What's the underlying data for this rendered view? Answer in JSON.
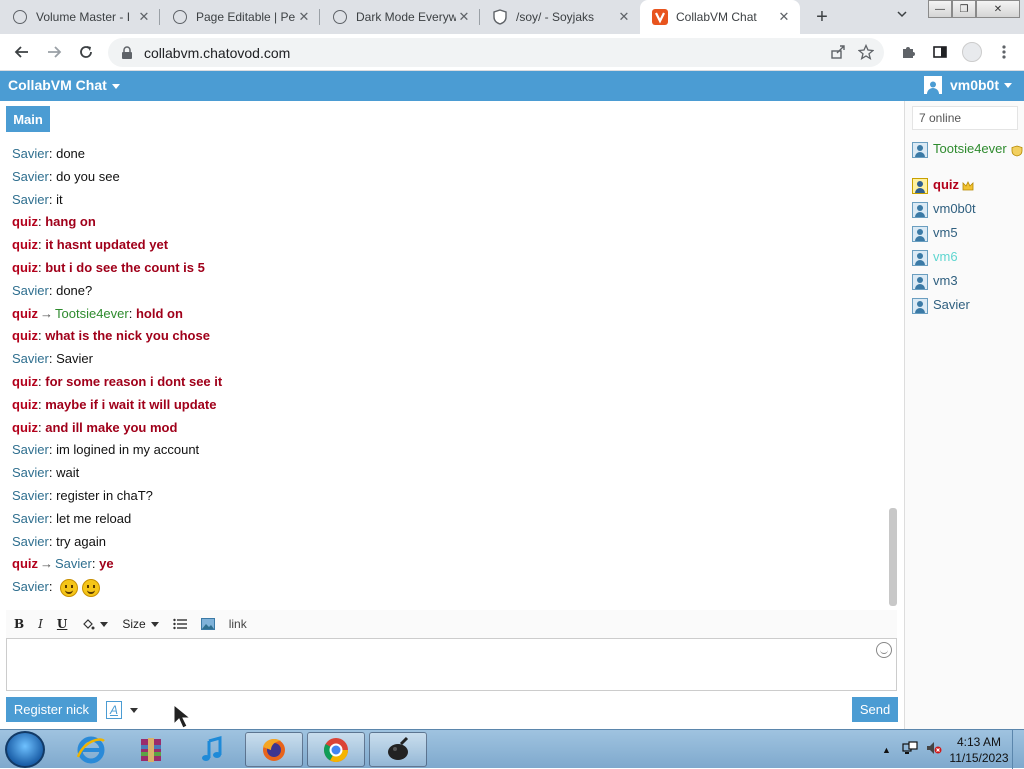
{
  "browser": {
    "tabs": [
      {
        "title": "Volume Master - I",
        "icon": "globe-outline"
      },
      {
        "title": "Page Editable | Pe",
        "icon": "globe-outline"
      },
      {
        "title": "Dark Mode Everyw",
        "icon": "globe-outline"
      },
      {
        "title": "/soy/ - Soyjaks",
        "icon": "shield"
      },
      {
        "title": "CollabVM Chat",
        "icon": "chatovod-v",
        "active": true
      }
    ],
    "url": "collabvm.chatovod.com"
  },
  "app": {
    "title": "CollabVM Chat",
    "username": "vm0b0t",
    "accent_color": "#4b9cd3",
    "active_room_tab": "Main"
  },
  "messages": [
    {
      "from": "Savier",
      "text": "done"
    },
    {
      "from": "Savier",
      "text": "do you see"
    },
    {
      "from": "Savier",
      "text": "it"
    },
    {
      "from": "quiz",
      "text": "hang on"
    },
    {
      "from": "quiz",
      "text": "it hasnt updated yet"
    },
    {
      "from": "quiz",
      "text": "but i do see the count is 5"
    },
    {
      "from": "Savier",
      "text": "done?"
    },
    {
      "from": "quiz",
      "to": "Tootsie4ever",
      "text": "hold on"
    },
    {
      "from": "quiz",
      "text": "what is the nick you chose"
    },
    {
      "from": "Savier",
      "text": "Savier"
    },
    {
      "from": "quiz",
      "text": "for some reason i dont see it"
    },
    {
      "from": "quiz",
      "text": "maybe if i wait it will update"
    },
    {
      "from": "quiz",
      "text": "and ill make you mod"
    },
    {
      "from": "Savier",
      "text": "im logined in my account"
    },
    {
      "from": "Savier",
      "text": "wait"
    },
    {
      "from": "Savier",
      "text": "register in chaT?"
    },
    {
      "from": "Savier",
      "text": "let me reload"
    },
    {
      "from": "Savier",
      "text": "try again"
    },
    {
      "from": "quiz",
      "to": "Savier",
      "text": "ye"
    },
    {
      "from": "Savier",
      "text": "",
      "emoji": [
        "smiley",
        "smiley"
      ]
    }
  ],
  "editor": {
    "bold": "B",
    "italic": "I",
    "underline": "U",
    "size_label": "Size",
    "link_label": "link",
    "font_label": "A",
    "register_label": "Register nick",
    "send_label": "Send"
  },
  "sidebar": {
    "online_count": "7 online",
    "users": [
      {
        "name": "Tootsie4ever",
        "color": "#2e8b2e",
        "badge": "shield-badge",
        "role": "moderator"
      },
      {
        "name": "quiz",
        "color": "#b3001b",
        "badge": "crown-badge",
        "role": "owner"
      },
      {
        "name": "vm0b0t",
        "color": "#2f5f7f"
      },
      {
        "name": "vm5",
        "color": "#2f5f7f"
      },
      {
        "name": "vm6",
        "color": "#5fd6d0"
      },
      {
        "name": "vm3",
        "color": "#2f5f7f"
      },
      {
        "name": "Savier",
        "color": "#2f5f7f"
      }
    ]
  },
  "taskbar": {
    "apps": [
      "internet-explorer",
      "winrar",
      "itunes",
      "firefox",
      "chrome",
      "unknown-app"
    ],
    "time": "4:13 AM",
    "date": "11/15/2023"
  }
}
